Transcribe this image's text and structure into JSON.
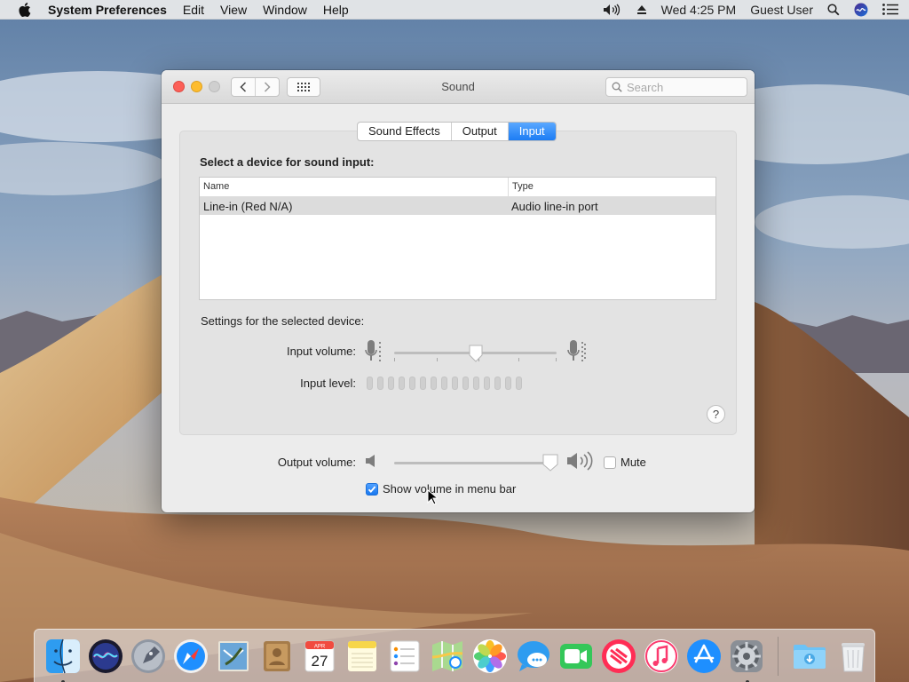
{
  "menubar": {
    "app_name": "System Preferences",
    "menus": [
      "Edit",
      "View",
      "Window",
      "Help"
    ],
    "clock": "Wed 4:25 PM",
    "user": "Guest User",
    "icons": [
      "apple-icon",
      "volume-icon",
      "eject-icon",
      "spotlight-icon",
      "siri-icon",
      "notification-center-icon"
    ]
  },
  "window": {
    "title": "Sound",
    "search_placeholder": "Search",
    "tabs": [
      {
        "label": "Sound Effects",
        "active": false
      },
      {
        "label": "Output",
        "active": false
      },
      {
        "label": "Input",
        "active": true
      }
    ],
    "input_section": {
      "heading": "Select a device for sound input:",
      "columns": {
        "name": "Name",
        "type": "Type"
      },
      "devices": [
        {
          "name": "Line-in (Red N/A)",
          "type": "Audio line-in port",
          "selected": true
        }
      ],
      "settings_label": "Settings for the selected device:",
      "input_volume_label": "Input volume:",
      "input_volume": 0.5,
      "input_level_label": "Input level:",
      "input_level": 0,
      "help_label": "?"
    },
    "output_volume_label": "Output volume:",
    "output_volume": 1.0,
    "mute_label": "Mute",
    "mute_checked": false,
    "show_volume_label": "Show volume in menu bar",
    "show_volume_checked": true
  },
  "dock": {
    "apps": [
      {
        "name": "Finder",
        "running": true
      },
      {
        "name": "Siri",
        "running": false
      },
      {
        "name": "Launchpad",
        "running": false
      },
      {
        "name": "Safari",
        "running": false
      },
      {
        "name": "Mail",
        "running": false
      },
      {
        "name": "Contacts",
        "running": false
      },
      {
        "name": "Calendar",
        "running": false,
        "month": "APR",
        "day": "27"
      },
      {
        "name": "Notes",
        "running": false
      },
      {
        "name": "Reminders",
        "running": false
      },
      {
        "name": "Maps",
        "running": false
      },
      {
        "name": "Photos",
        "running": false
      },
      {
        "name": "Messages",
        "running": false
      },
      {
        "name": "FaceTime",
        "running": false
      },
      {
        "name": "News",
        "running": false
      },
      {
        "name": "iTunes",
        "running": false
      },
      {
        "name": "App Store",
        "running": false
      },
      {
        "name": "System Preferences",
        "running": true
      }
    ],
    "stacks": [
      "Downloads",
      "Trash"
    ]
  }
}
